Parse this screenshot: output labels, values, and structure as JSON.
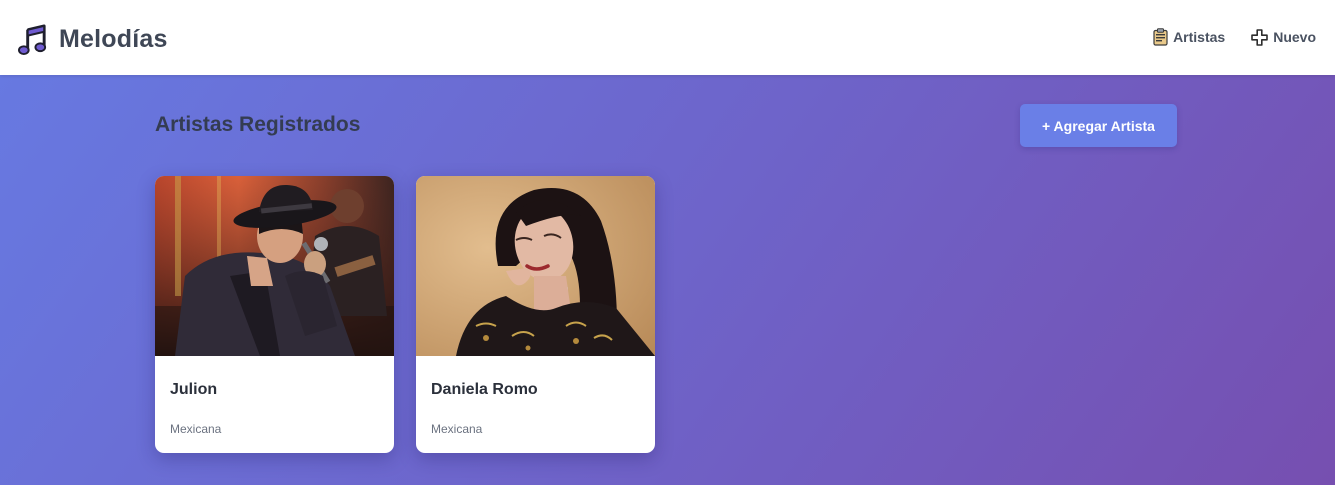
{
  "header": {
    "brand_name": "Melodías",
    "brand_icon": "music-notes-icon",
    "nav": [
      {
        "label": "Artistas",
        "icon": "clipboard-icon"
      },
      {
        "label": "Nuevo",
        "icon": "plus-icon"
      }
    ]
  },
  "main": {
    "title": "Artistas Registrados",
    "add_button_label": "+ Agregar Artista",
    "cards": [
      {
        "name": "Julion",
        "nationality": "Mexicana",
        "photo": "artist-photo-julion"
      },
      {
        "name": "Daniela Romo",
        "nationality": "Mexicana",
        "photo": "artist-photo-daniela-romo"
      }
    ]
  },
  "colors": {
    "gradient_start": "#6779e1",
    "gradient_end": "#764fb0",
    "button": "#6a7fe7",
    "brand_text": "#3f4756",
    "brand_icon_fill": "#6f5bd0"
  }
}
